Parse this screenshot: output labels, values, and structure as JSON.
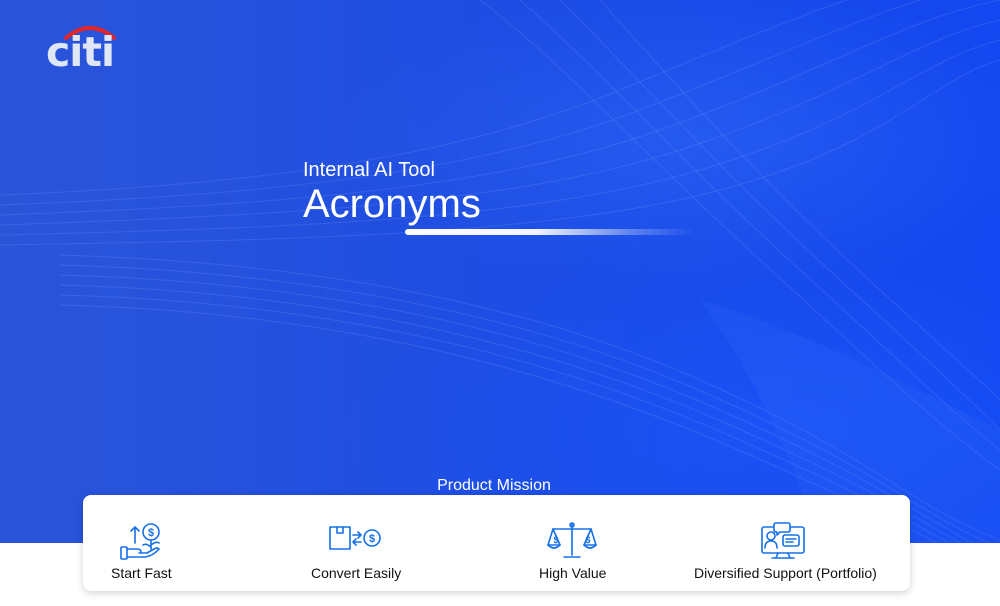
{
  "brand": {
    "logo_text": "citi",
    "arc_color": "#e0262b"
  },
  "hero": {
    "subtitle": "Internal AI Tool",
    "title": "Acronyms"
  },
  "mission": {
    "label": "Product Mission",
    "features": [
      {
        "label": "Start Fast",
        "icon": "hand-coin-growth-icon"
      },
      {
        "label": "Convert Easily",
        "icon": "box-exchange-dollar-icon"
      },
      {
        "label": "High Value",
        "icon": "balance-scale-dollar-icon"
      },
      {
        "label": "Diversified Support (Portfolio)",
        "icon": "monitor-support-chat-icon"
      }
    ]
  },
  "colors": {
    "hero_blue": "#1a4be6",
    "icon_blue": "#1570e8",
    "card_bg": "#ffffff"
  }
}
